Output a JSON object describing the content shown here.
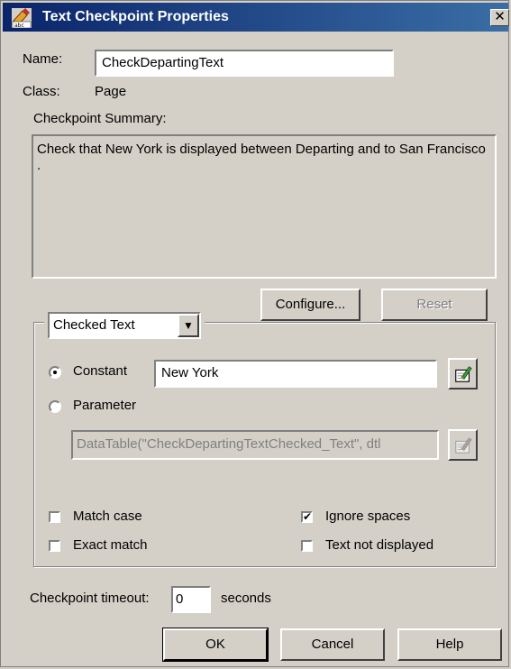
{
  "window": {
    "title": "Text Checkpoint Properties",
    "close_label": "✕",
    "icon": "text-checkpoint-icon"
  },
  "name": {
    "label": "Name:",
    "value": "CheckDepartingText"
  },
  "class": {
    "label": "Class:",
    "value": "Page"
  },
  "summary": {
    "label": "Checkpoint Summary:",
    "text": "Check that New York  is displayed between Departing and to San Francisco ."
  },
  "buttons": {
    "configure": "Configure...",
    "reset": "Reset",
    "ok": "OK",
    "cancel": "Cancel",
    "help": "Help"
  },
  "checked_text_select": {
    "value": "Checked Text",
    "arrow": "▼"
  },
  "constant": {
    "label": "Constant",
    "value": "New York",
    "selected": true
  },
  "parameter": {
    "label": "Parameter",
    "value": "DataTable(\"CheckDepartingTextChecked_Text\", dtl",
    "selected": false
  },
  "options": {
    "match_case": {
      "label": "Match case",
      "checked": false
    },
    "exact_match": {
      "label": "Exact match",
      "checked": false
    },
    "ignore_spaces": {
      "label": "Ignore spaces",
      "checked": true
    },
    "text_not_displayed": {
      "label": "Text not displayed",
      "checked": false
    }
  },
  "timeout": {
    "label": "Checkpoint timeout:",
    "value": "0",
    "unit": "seconds"
  },
  "icons": {
    "edit_constant": "edit-pencil-icon",
    "edit_parameter": "edit-pencil-icon"
  }
}
